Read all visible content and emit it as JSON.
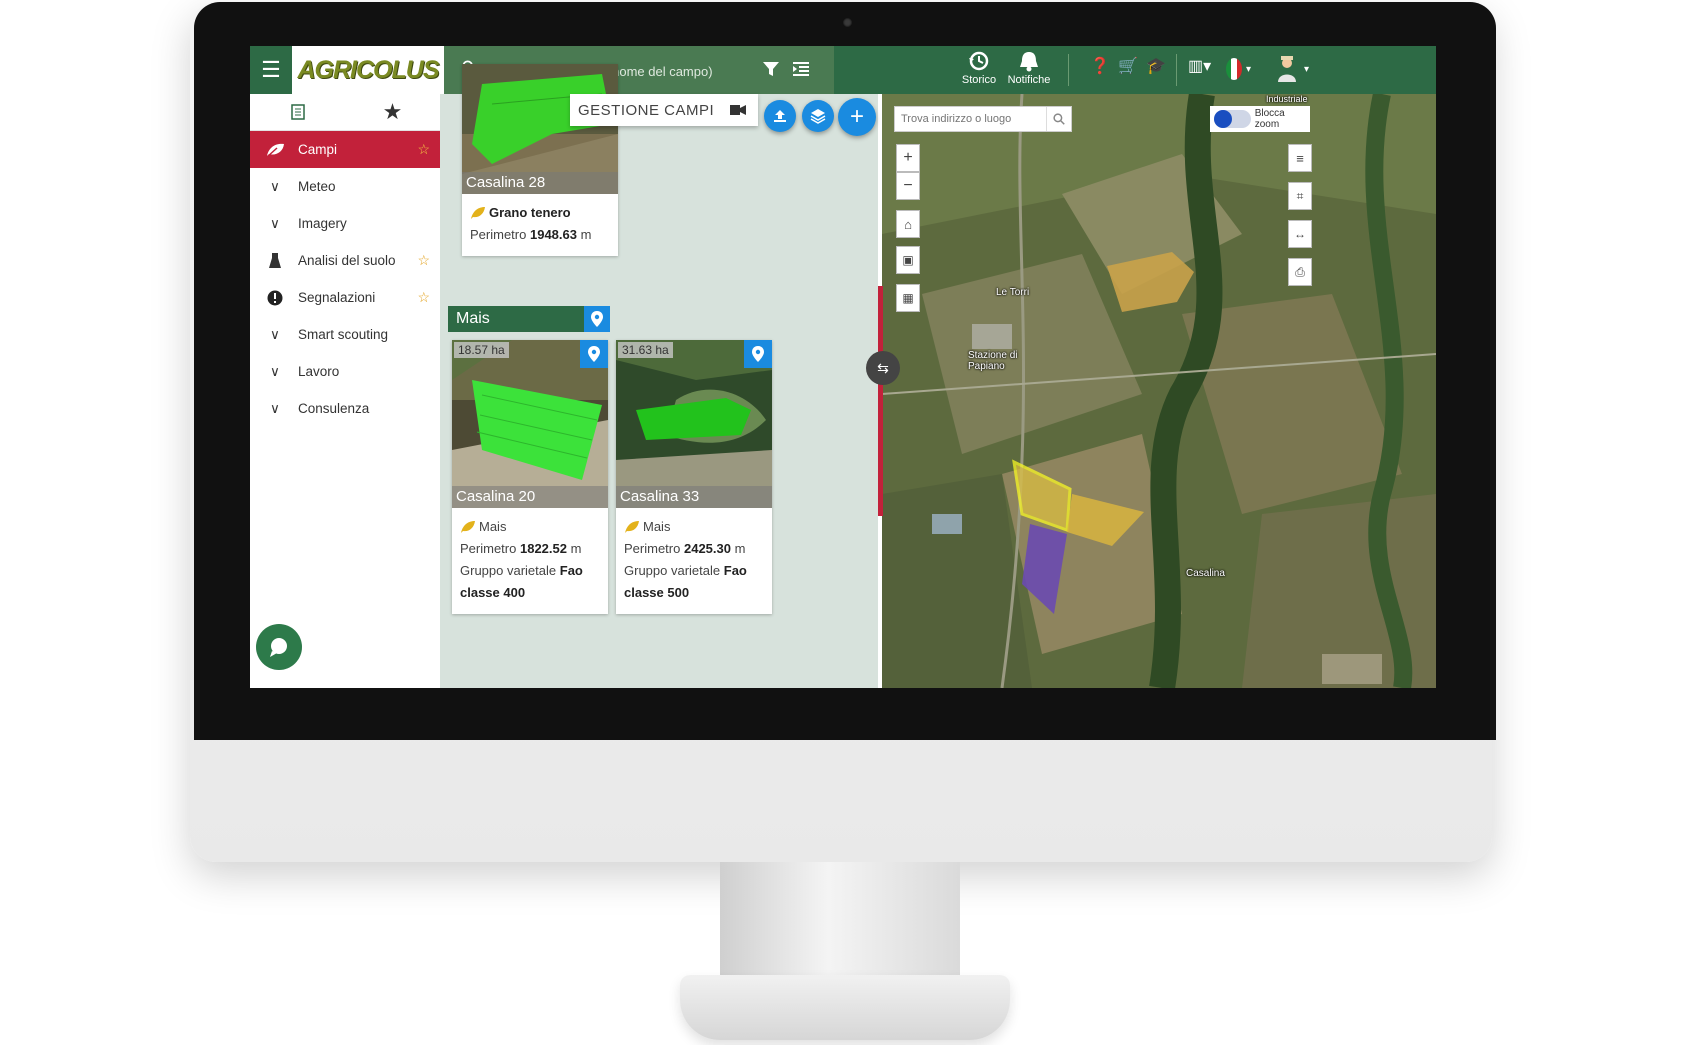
{
  "topbar": {
    "logo": "AGRICOLUS",
    "search_placeholder": "Cerca per nome (es: nome del campo)",
    "storico": "Storico",
    "notifiche": "Notifiche"
  },
  "sidebar": {
    "items": [
      {
        "label": "Campi",
        "icon": "leaf-icon",
        "starred": true,
        "active": true
      },
      {
        "label": "Meteo",
        "icon": "chevron-down-icon"
      },
      {
        "label": "Imagery",
        "icon": "chevron-down-icon"
      },
      {
        "label": "Analisi del suolo",
        "icon": "flask-icon",
        "starred": true
      },
      {
        "label": "Segnalazioni",
        "icon": "alert-icon",
        "starred": true
      },
      {
        "label": "Smart scouting",
        "icon": "chevron-down-icon"
      },
      {
        "label": "Lavoro",
        "icon": "chevron-down-icon"
      },
      {
        "label": "Consulenza",
        "icon": "chevron-down-icon"
      }
    ]
  },
  "content": {
    "header": "GESTIONE CAMPI",
    "group": "Mais",
    "cards": [
      {
        "name": "Casalina 28",
        "crop": "Grano tenero",
        "perimeter_label": "Perimetro",
        "perimeter": "1948.63",
        "unit": "m"
      },
      {
        "name": "Casalina 20",
        "area": "18.57",
        "area_unit": "ha",
        "crop": "Mais",
        "perimeter_label": "Perimetro",
        "perimeter": "1822.52",
        "unit": "m",
        "group_label": "Gruppo varietale",
        "group_value": "Fao",
        "class_value": "classe 400"
      },
      {
        "name": "Casalina 33",
        "area": "31.63",
        "area_unit": "ha",
        "crop": "Mais",
        "perimeter_label": "Perimetro",
        "perimeter": "2425.30",
        "unit": "m",
        "group_label": "Gruppo varietale",
        "group_value": "Fao",
        "class_value": "classe 500"
      }
    ]
  },
  "map": {
    "search_placeholder": "Trova indirizzo o luogo",
    "lock_zoom": "Blocca zoom",
    "labels": [
      "Le Torri",
      "Stazione di Papiano",
      "Casalina",
      "Industriale"
    ]
  },
  "colors": {
    "brand_green": "#2d6a45",
    "active_red": "#c2213a",
    "accent_blue": "#1a8be0"
  }
}
